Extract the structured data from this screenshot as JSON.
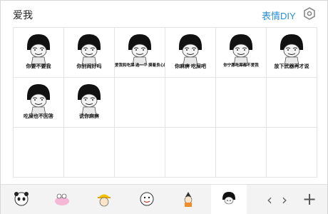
{
  "header": {
    "title": "爱我",
    "diy_label": "表情DIY",
    "settings_icon": "hexagon-settings-icon"
  },
  "accent_color": "#2a8fd6",
  "stickers": [
    {
      "caption": "你要不要我"
    },
    {
      "caption": "你别闹好吗"
    },
    {
      "caption": "爱我和吃屎 选一个 摸着良心回答"
    },
    {
      "caption": "你麻痹 吃屎吧"
    },
    {
      "caption": "你宁愿吃屎都不爱我"
    },
    {
      "caption": "放下武器再才说"
    },
    {
      "caption": "吃屎也不回答"
    },
    {
      "caption": "说你麻痹"
    }
  ],
  "tabs": [
    {
      "icon": "panda-sticker-icon"
    },
    {
      "icon": "pink-cartoon-sticker-icon"
    },
    {
      "icon": "yellow-hat-sticker-icon"
    },
    {
      "icon": "face-sticker-icon"
    },
    {
      "icon": "orange-character-sticker-icon"
    },
    {
      "icon": "mushroom-head-sticker-icon",
      "active": true
    }
  ],
  "footer": {
    "prev_label": "‹",
    "next_label": "›",
    "add_label": "+"
  }
}
